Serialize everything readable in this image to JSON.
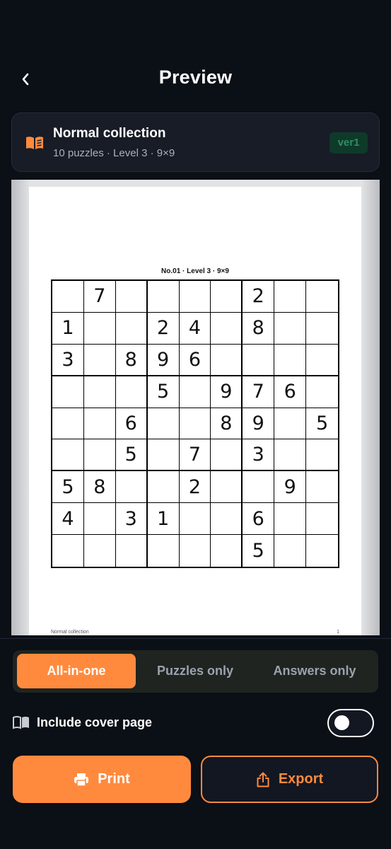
{
  "header": {
    "title": "Preview",
    "back_icon": "chevron-left-icon"
  },
  "collection": {
    "title": "Normal collection",
    "subtitle": "10 puzzles · Level 3 · 9×9",
    "version": "ver1",
    "icon": "book-icon"
  },
  "preview": {
    "caption": "No.01 · Level 3 · 9×9",
    "footer_left": "Normal collection",
    "footer_right": "1",
    "grid": [
      [
        "",
        "7",
        "",
        "",
        "",
        "",
        "2",
        "",
        ""
      ],
      [
        "1",
        "",
        "",
        "2",
        "4",
        "",
        "8",
        "",
        ""
      ],
      [
        "3",
        "",
        "8",
        "9",
        "6",
        "",
        "",
        "",
        ""
      ],
      [
        "",
        "",
        "",
        "5",
        "",
        "9",
        "7",
        "6",
        ""
      ],
      [
        "",
        "",
        "6",
        "",
        "",
        "8",
        "9",
        "",
        "5"
      ],
      [
        "",
        "",
        "5",
        "",
        "7",
        "",
        "3",
        "",
        ""
      ],
      [
        "5",
        "8",
        "",
        "",
        "2",
        "",
        "",
        "9",
        ""
      ],
      [
        "4",
        "",
        "3",
        "1",
        "",
        "",
        "6",
        "",
        ""
      ],
      [
        "",
        "",
        "",
        "",
        "",
        "",
        "5",
        "",
        ""
      ]
    ]
  },
  "mode_tabs": {
    "selected": "All-in-one",
    "options": [
      "All-in-one",
      "Puzzles only",
      "Answers only"
    ]
  },
  "cover_option": {
    "label": "Include cover page",
    "enabled": false,
    "icon": "open-book-icon"
  },
  "actions": {
    "print_label": "Print",
    "export_label": "Export",
    "print_icon": "printer-icon",
    "export_icon": "share-icon"
  },
  "colors": {
    "accent": "#ff8a3d",
    "background": "#0b0f16",
    "card": "#171c26",
    "badge_text": "#2f8e63"
  }
}
